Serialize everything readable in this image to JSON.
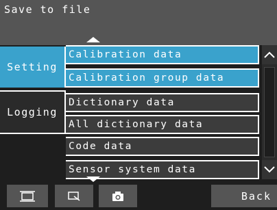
{
  "header": {
    "title": "Save to file"
  },
  "tabs": [
    {
      "label": "Setting",
      "active": true
    },
    {
      "label": "Logging",
      "active": false
    }
  ],
  "list": {
    "items": [
      {
        "label": "Calibration data"
      },
      {
        "label": "Calibration group data"
      },
      {
        "label": "Dictionary data"
      },
      {
        "label": "All dictionary data"
      },
      {
        "label": "Code data"
      },
      {
        "label": "Sensor system data"
      }
    ]
  },
  "scrollbar": {
    "up_icon": "chevron-up-icon",
    "down_icon": "chevron-down-icon"
  },
  "toolbar": {
    "buttons": [
      {
        "icon": "frame-icon"
      },
      {
        "icon": "zoom-icon"
      },
      {
        "icon": "camera-icon"
      }
    ],
    "back_label": "Back"
  },
  "colors": {
    "accent": "#3aa2cc",
    "panel": "#555555",
    "row": "#3c3c3c",
    "background": "#1e1e1e"
  }
}
